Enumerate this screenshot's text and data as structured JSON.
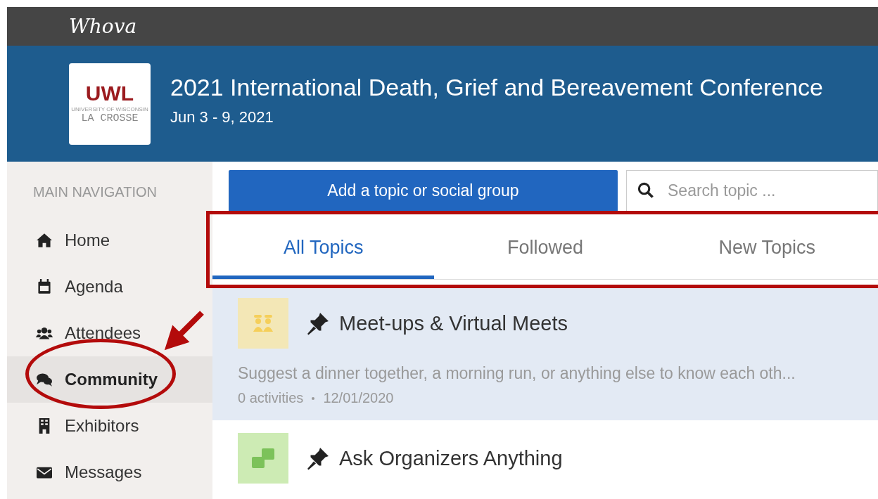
{
  "brand": "Whova",
  "event": {
    "logo": {
      "mark": "UWL",
      "subtitle": "UNIVERSITY OF WISCONSIN",
      "campus": "LA CROSSE"
    },
    "title": "2021 International Death, Grief and Bereavement Conference",
    "dates": "Jun 3 - 9, 2021"
  },
  "sidebar": {
    "heading": "MAIN NAVIGATION",
    "items": [
      {
        "label": "Home",
        "kind": "home",
        "selected": false
      },
      {
        "label": "Agenda",
        "kind": "calendar",
        "selected": false
      },
      {
        "label": "Attendees",
        "kind": "people",
        "selected": false
      },
      {
        "label": "Community",
        "kind": "chat",
        "selected": true
      },
      {
        "label": "Exhibitors",
        "kind": "building",
        "selected": false
      },
      {
        "label": "Messages",
        "kind": "mail",
        "selected": false
      }
    ]
  },
  "add_button": "Add a topic or social group",
  "search": {
    "placeholder": "Search topic ..."
  },
  "tabs": [
    {
      "label": "All Topics",
      "selected": true
    },
    {
      "label": "Followed",
      "selected": false
    },
    {
      "label": "New Topics",
      "selected": false
    }
  ],
  "topics": [
    {
      "title": "Meet-ups & Virtual Meets",
      "pinned": true,
      "kind": "meetup",
      "selected": true,
      "description": "Suggest a dinner together, a morning run, or anything else to know each oth...",
      "activities": "0 activities",
      "date": "12/01/2020"
    },
    {
      "title": "Ask Organizers Anything",
      "pinned": true,
      "kind": "qa",
      "selected": false
    }
  ],
  "annotations": [
    {
      "kind": "box"
    },
    {
      "kind": "ellipse"
    },
    {
      "kind": "arrow"
    }
  ]
}
